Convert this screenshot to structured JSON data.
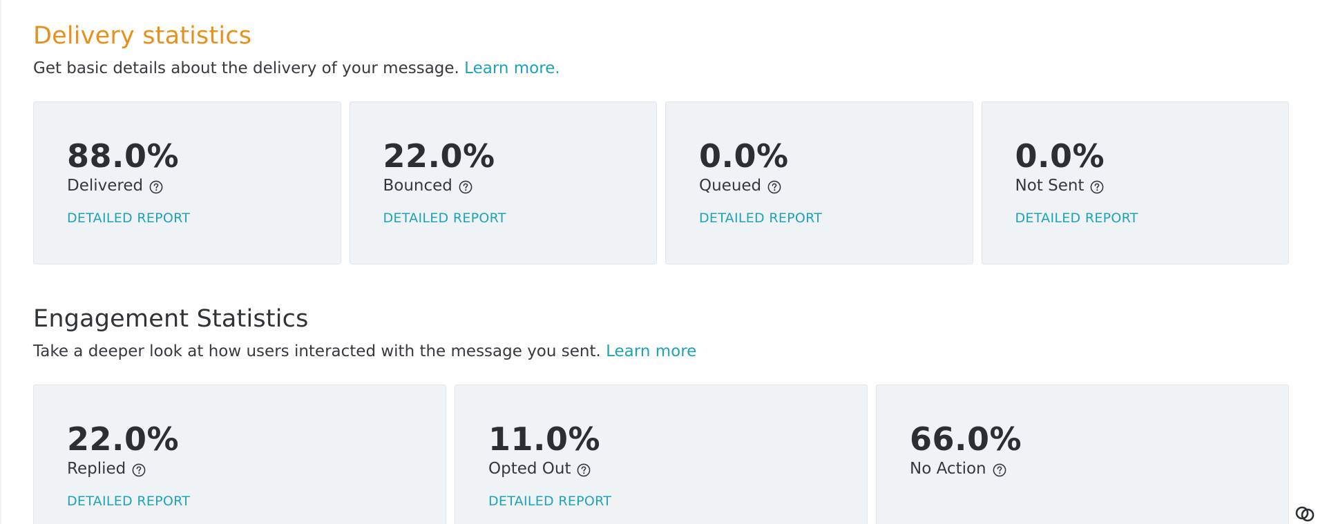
{
  "delivery": {
    "title": "Delivery statistics",
    "description": "Get basic details about the delivery of your message.",
    "learn_more": "Learn more.",
    "cards": [
      {
        "value": "88.0%",
        "label": "Delivered",
        "link": "DETAILED REPORT"
      },
      {
        "value": "22.0%",
        "label": "Bounced",
        "link": "DETAILED REPORT"
      },
      {
        "value": "0.0%",
        "label": "Queued",
        "link": "DETAILED REPORT"
      },
      {
        "value": "0.0%",
        "label": "Not Sent",
        "link": "DETAILED REPORT"
      }
    ]
  },
  "engagement": {
    "title": "Engagement Statistics",
    "description": "Take a deeper look at how users interacted with the message you sent.",
    "learn_more": "Learn more",
    "cards": [
      {
        "value": "22.0%",
        "label": "Replied",
        "link": "DETAILED REPORT"
      },
      {
        "value": "11.0%",
        "label": "Opted Out",
        "link": "DETAILED REPORT"
      },
      {
        "value": "66.0%",
        "label": "No Action"
      }
    ]
  },
  "icons": {
    "help": "question-circle-icon",
    "corner": "chain-link-icon"
  },
  "colors": {
    "delivery_title": "#e8901c",
    "link": "#1ea2b8",
    "card_bg": "#f0f3f6",
    "text": "#2f3237"
  }
}
